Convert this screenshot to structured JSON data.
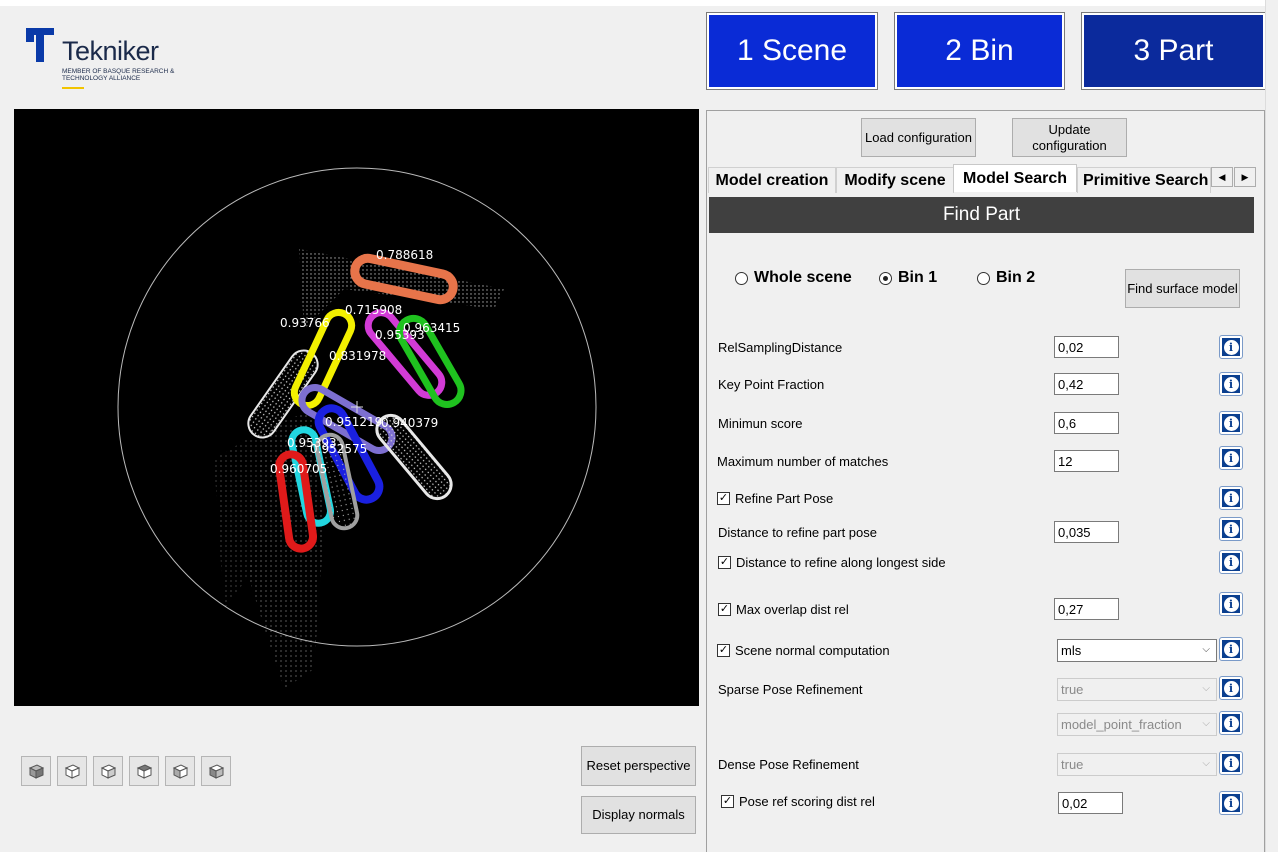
{
  "brand": {
    "name": "Tekniker",
    "tagline": "MEMBER OF BASQUE RESEARCH & TECHNOLOGY ALLIANCE",
    "colors": {
      "navy": "#1b2a4a",
      "accent": "#0a2bd6",
      "yellow": "#f2c400"
    }
  },
  "steps": [
    {
      "label": "1 Scene",
      "active": false
    },
    {
      "label": "2 Bin",
      "active": false
    },
    {
      "label": "3 Part",
      "active": true
    }
  ],
  "viewport": {
    "scores": [
      "0.788618",
      "0.715908",
      "0.93766",
      "0.963415",
      "0.95393",
      "0.831978",
      "0.951219",
      "0.940379",
      "0.95393",
      "0.952575",
      "0.960705"
    ],
    "colors": {
      "orange": "#e7744a",
      "yellow": "#f3f000",
      "purple": "#7d6fd0",
      "magenta": "#d23bd6",
      "green": "#1fc21f",
      "blue": "#1a20e0",
      "cyan": "#22d6e0",
      "red": "#e01a1a",
      "white": "#e8e8e8",
      "gray": "#a0a0a0"
    }
  },
  "view_buttons": [
    "cube-iso-icon",
    "cube-front-icon",
    "cube-side-icon",
    "cube-top-icon",
    "cube-bottom-icon",
    "cube-back-icon"
  ],
  "left_actions": {
    "reset": "Reset perspective",
    "normals": "Display normals"
  },
  "config": {
    "load": "Load configuration",
    "update": "Update configuration"
  },
  "tabs": [
    "Model creation",
    "Modify scene",
    "Model Search",
    "Primitive Search"
  ],
  "active_tab": "Model Search",
  "panel": {
    "title": "Find Part",
    "radios": [
      {
        "label": "Whole scene",
        "checked": false
      },
      {
        "label": "Bin 1",
        "checked": true
      },
      {
        "label": "Bin 2",
        "checked": false
      }
    ],
    "find_surface": "Find surface model",
    "params": [
      {
        "label": "RelSamplingDistance",
        "value": "0,02"
      },
      {
        "label": "Key Point Fraction",
        "value": "0,42"
      },
      {
        "label": "Minimun score",
        "value": "0,6"
      },
      {
        "label": "Maximum number of matches",
        "value": "12"
      }
    ],
    "refine_pose": {
      "label": "Refine Part Pose",
      "checked": true
    },
    "dist_refine": {
      "label": "Distance to refine part pose",
      "value": "0,035"
    },
    "dist_longest": {
      "label": "Distance to refine along longest side",
      "checked": true
    },
    "max_overlap": {
      "label": "Max overlap dist rel",
      "checked": true,
      "value": "0,27"
    },
    "scene_normal": {
      "label": "Scene normal computation",
      "checked": true,
      "value": "mls"
    },
    "sparse": {
      "label": "Sparse Pose Refinement",
      "value": "true",
      "value2": "model_point_fraction"
    },
    "dense": {
      "label": "Dense Pose Refinement",
      "value": "true"
    },
    "pose_ref": {
      "label": "Pose ref scoring dist rel",
      "checked": true,
      "value": "0,02"
    }
  }
}
